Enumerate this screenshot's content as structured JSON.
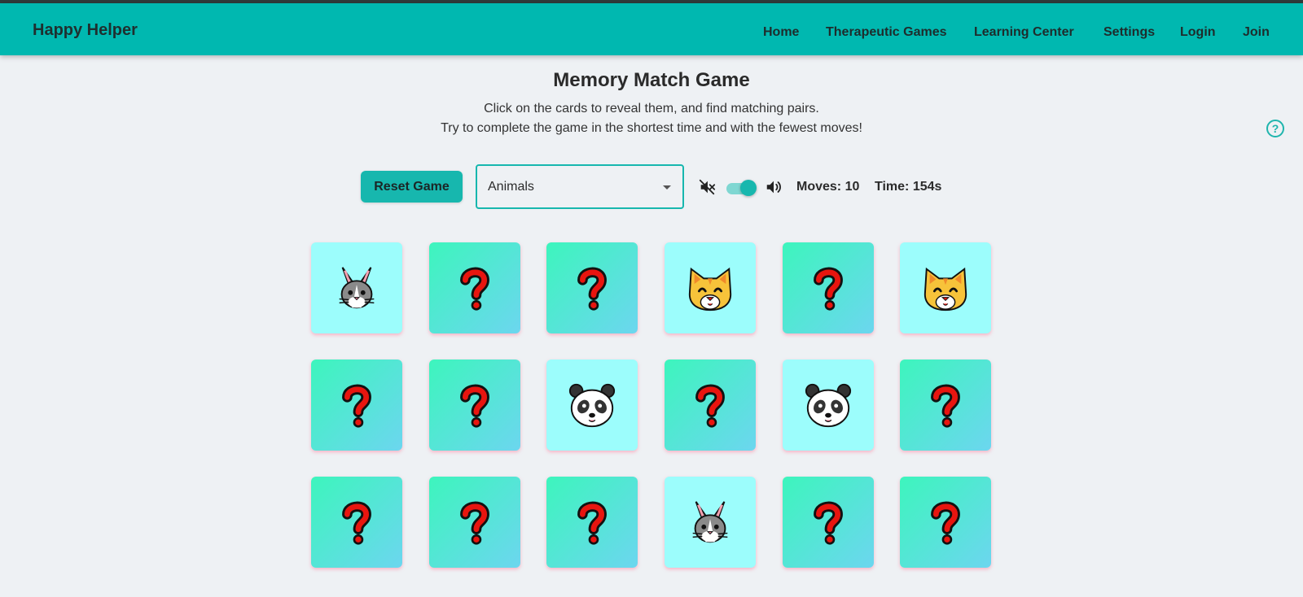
{
  "header": {
    "brand": "Happy Helper",
    "nav": [
      "Home",
      "Therapeutic Games",
      "Learning Center",
      "Settings",
      "Login",
      "Join"
    ]
  },
  "main": {
    "title": "Memory Match Game",
    "instructions": [
      "Click on the cards to reveal them, and find matching pairs.",
      "Try to complete the game in the shortest time and with the fewest moves!"
    ],
    "help_icon": "help-circle-icon",
    "help_glyph": "?"
  },
  "controls": {
    "reset_label": "Reset Game",
    "category_selected": "Animals",
    "sound_enabled": true,
    "moves_text": "Moves: 10",
    "time_text": "Time: 154s"
  },
  "colors": {
    "accent": "#00b8b0",
    "card_hidden_from": "#3df5bd",
    "card_hidden_to": "#6cd6ef",
    "card_revealed": "#9cfdfc"
  },
  "board": {
    "columns": 6,
    "cards": [
      {
        "state": "revealed",
        "icon": "rabbit"
      },
      {
        "state": "hidden",
        "icon": "question-mark"
      },
      {
        "state": "hidden",
        "icon": "question-mark"
      },
      {
        "state": "revealed",
        "icon": "cat"
      },
      {
        "state": "hidden",
        "icon": "question-mark"
      },
      {
        "state": "revealed",
        "icon": "cat"
      },
      {
        "state": "hidden",
        "icon": "question-mark"
      },
      {
        "state": "hidden",
        "icon": "question-mark"
      },
      {
        "state": "revealed",
        "icon": "panda"
      },
      {
        "state": "hidden",
        "icon": "question-mark"
      },
      {
        "state": "revealed",
        "icon": "panda"
      },
      {
        "state": "hidden",
        "icon": "question-mark"
      },
      {
        "state": "hidden",
        "icon": "question-mark"
      },
      {
        "state": "hidden",
        "icon": "question-mark"
      },
      {
        "state": "hidden",
        "icon": "question-mark"
      },
      {
        "state": "revealed",
        "icon": "rabbit"
      },
      {
        "state": "hidden",
        "icon": "question-mark"
      },
      {
        "state": "hidden",
        "icon": "question-mark"
      }
    ]
  }
}
